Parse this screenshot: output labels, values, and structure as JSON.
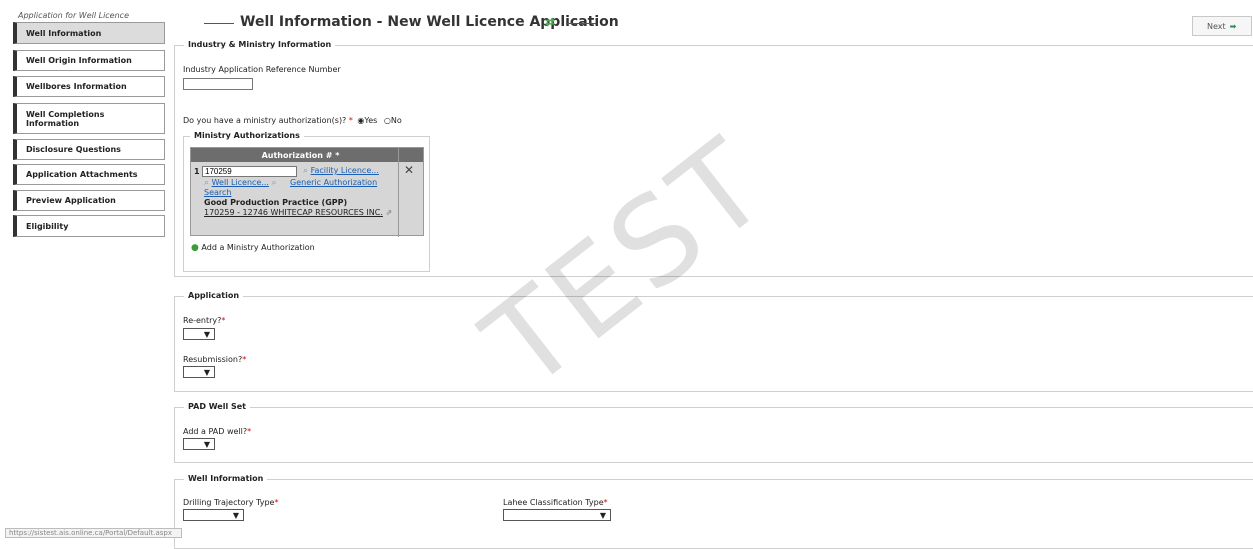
{
  "sidebar": {
    "caption": "Application for Well Licence",
    "items": [
      {
        "label": "Well Information",
        "active": true
      },
      {
        "label": "Well Origin Information"
      },
      {
        "label": "Wellbores Information"
      },
      {
        "label": "Well Completions Information"
      },
      {
        "label": "Disclosure Questions"
      },
      {
        "label": "Application Attachments"
      },
      {
        "label": "Preview Application"
      },
      {
        "label": "Eligibility"
      }
    ]
  },
  "header": {
    "title": "Well Information - New Well Licence Application",
    "refresh_icon": "refresh-icon",
    "next_label": "Next",
    "next_icon": "arrow-right-icon"
  },
  "industry": {
    "legend": "Industry & Ministry Information",
    "ref_label": "Industry Application Reference Number",
    "ref_value": "",
    "auth_question": "Do you have a ministry authorization(s)?",
    "yes_label": "Yes",
    "no_label": "No",
    "auth_selected": "Yes"
  },
  "ministry": {
    "legend": "Ministry Authorizations",
    "column_header": "Authorization # *",
    "row_number": "1",
    "auth_value": "170259",
    "facility_link": "Facility Licence...",
    "well_link": "Well Licence...",
    "generic_link": "Generic Authorization Search",
    "practice": "Good Production Practice (GPP)",
    "company_link": "170259 - 12746 WHITECAP RESOURCES INC.",
    "add_label": "Add a Ministry Authorization"
  },
  "application": {
    "legend": "Application",
    "reentry_label": "Re-entry?",
    "resubmission_label": "Resubmission?"
  },
  "pad": {
    "legend": "PAD Well Set",
    "add_label": "Add a PAD well?"
  },
  "wellinfo": {
    "legend": "Well Information",
    "trajectory_label": "Drilling Trajectory Type",
    "lahee_label": "Lahee Classification Type"
  },
  "watermark": "TEST",
  "status_url": "https://sistest.ais.online.ca/Portal/Default.aspx",
  "colors": {
    "accent": "#1a5fb4",
    "required": "#dd0000",
    "refresh": "#4caf50"
  }
}
